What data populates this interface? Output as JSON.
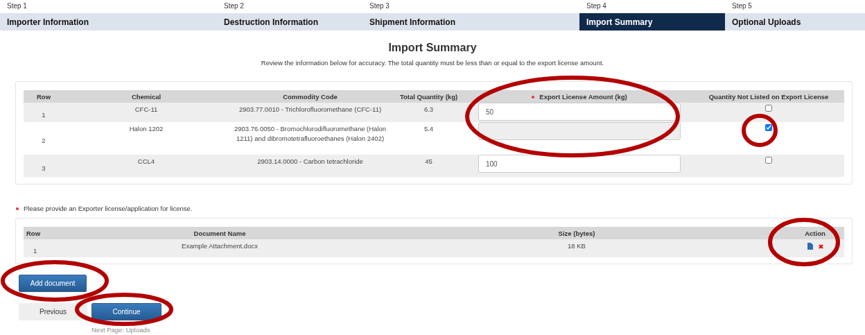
{
  "steps": [
    {
      "step": "Step 1",
      "label": "Importer Information",
      "selected": false
    },
    {
      "step": "Step 2",
      "label": "Destruction Information",
      "selected": false
    },
    {
      "step": "Step 3",
      "label": "Shipment Information",
      "selected": false
    },
    {
      "step": "Step 4",
      "label": "Import Summary",
      "selected": true
    },
    {
      "step": "Step 5",
      "label": "Optional Uploads",
      "selected": false
    }
  ],
  "title": "Import Summary",
  "subtitle": "Review the information below for accuracy. The total quantity must be less than or equal to the export license amount.",
  "summary_table": {
    "columns": [
      {
        "label": "Row",
        "required": false
      },
      {
        "label": "Chemical",
        "required": false
      },
      {
        "label": "Commodity Code",
        "required": false
      },
      {
        "label": "Total Quantity (kg)",
        "required": false
      },
      {
        "label": "Export License Amount (kg)",
        "required": true
      },
      {
        "label": "Quantity Not Listed on Export License",
        "required": false
      }
    ],
    "rows": [
      {
        "row": "1",
        "chemical": "CFC-11",
        "code": "2903.77.0010 - Trichlorofluoromethane (CFC-11)",
        "total": "6.3",
        "amount": "50",
        "amount_disabled": false,
        "not_listed": false
      },
      {
        "row": "2",
        "chemical": "Halon 1202",
        "code": "2903.76.0050 - Bromochlorodifluoromethane (Halon 1211) and dibromotetrafluoroethanes (Halon 2402)",
        "total": "5.4",
        "amount_disabled": true,
        "not_listed": true
      },
      {
        "row": "3",
        "chemical": "CCL4",
        "code": "2903.14.0000 - Carbon tetrachloride",
        "total": "45",
        "amount": "100",
        "amount_disabled": false,
        "not_listed": false
      }
    ]
  },
  "required_note": "Please provide an Exporter license/application for license.",
  "documents_table": {
    "columns": [
      "Row",
      "Document Name",
      "Size (bytes)",
      "Action"
    ],
    "rows": [
      {
        "row": "1",
        "name": "Example Attachment.docx",
        "size": "18 KB"
      }
    ]
  },
  "add_button": "Add document",
  "previous_button": "Previous",
  "continue_button": "Continue",
  "next_hint": "Next Page: Uploads"
}
